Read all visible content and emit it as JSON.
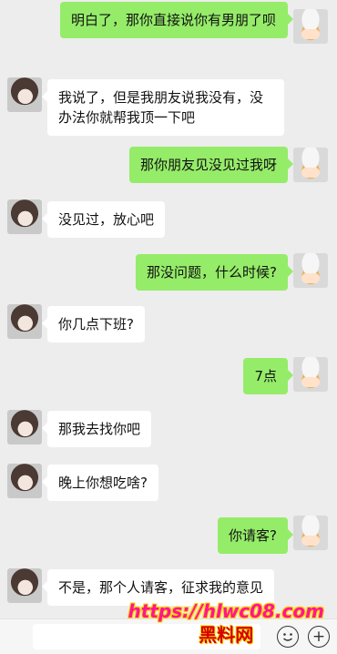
{
  "messages": [
    {
      "side": "out",
      "text": "明白了，那你直接说你有男朋了呗"
    },
    {
      "side": "in",
      "text": "我说了，但是我朋友说我没有，没办法你就帮我顶一下吧"
    },
    {
      "side": "out",
      "text": "那你朋友见没见过我呀"
    },
    {
      "side": "in",
      "text": "没见过，放心吧"
    },
    {
      "side": "out",
      "text": "那没问题，什么时候?"
    },
    {
      "side": "in",
      "text": "你几点下班?"
    },
    {
      "side": "out",
      "text": "7点"
    },
    {
      "side": "in",
      "text": "那我去找你吧"
    },
    {
      "side": "in",
      "text": "晚上你想吃啥?"
    },
    {
      "side": "out",
      "text": "你请客?"
    },
    {
      "side": "in",
      "text": "不是，那个人请客，征求我的意见"
    }
  ],
  "watermark": {
    "url": "https://hlwc08.com",
    "name": "黑料网"
  },
  "input_bar": {
    "emoji_icon": "emoji-icon",
    "add_icon": "plus-icon"
  },
  "colors": {
    "background": "#ededed",
    "outgoing_bubble": "#95ec69",
    "incoming_bubble": "#ffffff",
    "watermark_url": "#ff1493",
    "watermark_name": "#d40000"
  }
}
